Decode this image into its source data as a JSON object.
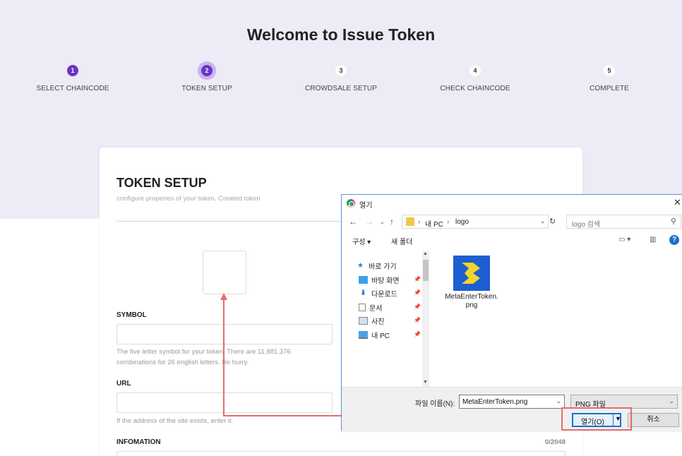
{
  "page": {
    "title": "Welcome to Issue Token"
  },
  "steps": [
    {
      "num": "1",
      "label": "SELECT CHAINCODE",
      "state": "done"
    },
    {
      "num": "2",
      "label": "TOKEN SETUP",
      "state": "active"
    },
    {
      "num": "3",
      "label": "CROWDSALE SETUP",
      "state": "pending"
    },
    {
      "num": "4",
      "label": "CHECK CHAINCODE",
      "state": "pending"
    },
    {
      "num": "5",
      "label": "COMPLETE",
      "state": "pending"
    }
  ],
  "card": {
    "title": "TOKEN SETUP",
    "subtitle": "configure properies of your token. Created token",
    "symbol_label": "SYMBOL",
    "symbol_help": "The five letter symbol for your token. There are 11,881,376 combinations for 26 english letters. Be hurry.",
    "url_label": "URL",
    "url_help": "If the address of the site exists, enter it.",
    "info_label": "INFOMATION",
    "info_counter": "0/2048"
  },
  "dialog": {
    "title": "열기",
    "path": [
      "내 PC",
      "logo"
    ],
    "search_placeholder": "logo 검색",
    "organize": "구성 ▾",
    "new_folder": "새 폴더",
    "nav_items": [
      {
        "label": "바로 가기",
        "icon": "star-icon"
      },
      {
        "label": "바탕 화면",
        "icon": "desktop-icon"
      },
      {
        "label": "다운로드",
        "icon": "download-icon"
      },
      {
        "label": "문서",
        "icon": "document-icon"
      },
      {
        "label": "사진",
        "icon": "picture-icon"
      },
      {
        "label": "내 PC",
        "icon": "computer-icon"
      }
    ],
    "file_name_line1": "MetaEnterToken.",
    "file_name_line2": "png",
    "filename_label": "파일 이름(N):",
    "filename_value": "MetaEnterToken.png",
    "filetype_value": "PNG 파일",
    "open_label": "열기(O)",
    "cancel_label": "취소"
  },
  "colors": {
    "accent": "#6a35c2",
    "hero_bg": "#ecebf6",
    "annotation": "#e96a6a",
    "dialog_blue": "#1c6fd1"
  }
}
